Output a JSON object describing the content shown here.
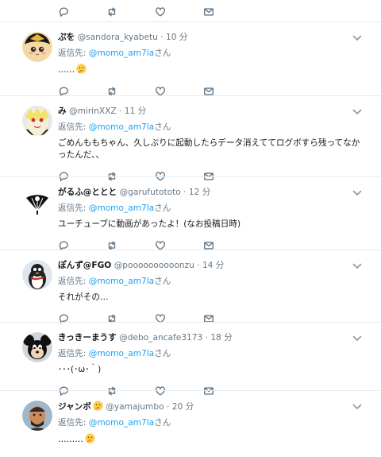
{
  "reply_prefix": "返信先:",
  "reply_suffix": "さん",
  "top_actions": [
    "reply-icon",
    "retweet-icon",
    "like-icon",
    "dm-icon"
  ],
  "tweets": [
    {
      "name": "ぷを",
      "handle": "@sandora_kyabetu",
      "time": "10 分",
      "mention": "@momo_am7la",
      "text": "……",
      "emoji": "thinking-emoji"
    },
    {
      "name": "み",
      "handle": "@mirinXXZ",
      "time": "11 分",
      "mention": "@momo_am7la",
      "text": "ごめんももちゃん、久しぶりに起動したらデータ消えててログボすら残ってなかったんだ、、"
    },
    {
      "name": "がるふ@ととと",
      "handle": "@garufutototo",
      "time": "12 分",
      "mention": "@momo_am7la",
      "text": "ユーチューブに動画があったよ！(なお投稿日時)"
    },
    {
      "name": "ぽんず@FGO",
      "handle": "@poooooooooonzu",
      "time": "14 分",
      "mention": "@momo_am7la",
      "text": "それがその…"
    },
    {
      "name": "きっきーまうす",
      "handle": "@debo_ancafe3173",
      "time": "18 分",
      "mention": "@momo_am7la",
      "text": "･･･(･ω･｀)"
    },
    {
      "name": "ジャンボ",
      "name_emoji": "thinking-emoji",
      "handle": "@yamajumbo",
      "time": "20 分",
      "mention": "@momo_am7la",
      "text": "………",
      "emoji": "thinking-emoji"
    }
  ],
  "colors": {
    "link": "#1da1f2",
    "muted": "#657786",
    "border": "#e6ecf0",
    "text": "#14171a"
  }
}
